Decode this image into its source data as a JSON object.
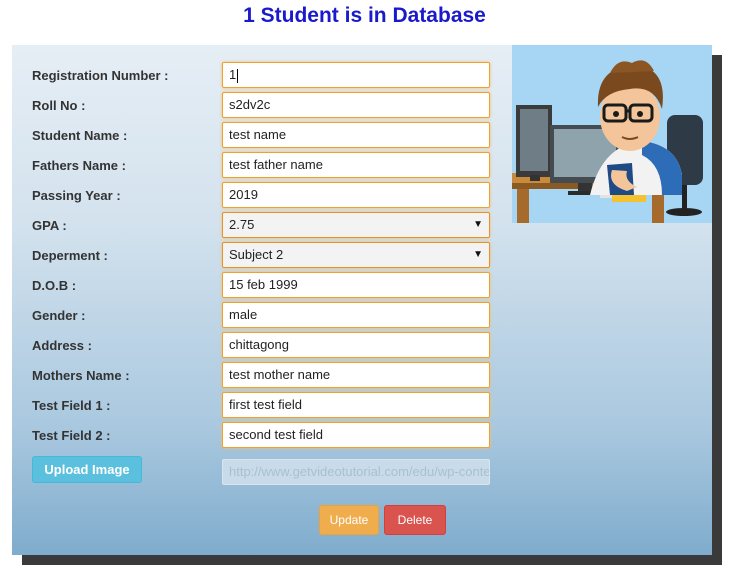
{
  "page": {
    "title": "1 Student is in Database"
  },
  "form": {
    "fields": [
      {
        "label": "Registration Number :",
        "value": "1"
      },
      {
        "label": "Roll No :",
        "value": "s2dv2c"
      },
      {
        "label": "Student Name :",
        "value": "test name"
      },
      {
        "label": "Fathers Name :",
        "value": "test father name"
      },
      {
        "label": "Passing Year :",
        "value": "2019"
      },
      {
        "label": "GPA :",
        "value": "2.75"
      },
      {
        "label": "Deperment :",
        "value": "Subject 2"
      },
      {
        "label": "D.O.B :",
        "value": "15 feb 1999"
      },
      {
        "label": "Gender :",
        "value": "male"
      },
      {
        "label": "Address :",
        "value": "chittagong"
      },
      {
        "label": "Mothers Name :",
        "value": "test mother name"
      },
      {
        "label": "Test Field 1 :",
        "value": "first test field"
      },
      {
        "label": "Test Field 2 :",
        "value": "second test field"
      }
    ],
    "upload_label": "Upload Image",
    "image_path": "http://www.getvideotutorial.com/edu/wp-content/",
    "update_label": "Update",
    "delete_label": "Delete"
  },
  "colors": {
    "title": "#1a1acc",
    "input_border": "#f0a030",
    "upload_button": "#5bc0de",
    "update_button": "#f0ad4e",
    "delete_button": "#d9534f"
  },
  "icons": {
    "select_arrow": "dropdown-arrow-icon",
    "avatar": "student-at-computer-illustration"
  }
}
